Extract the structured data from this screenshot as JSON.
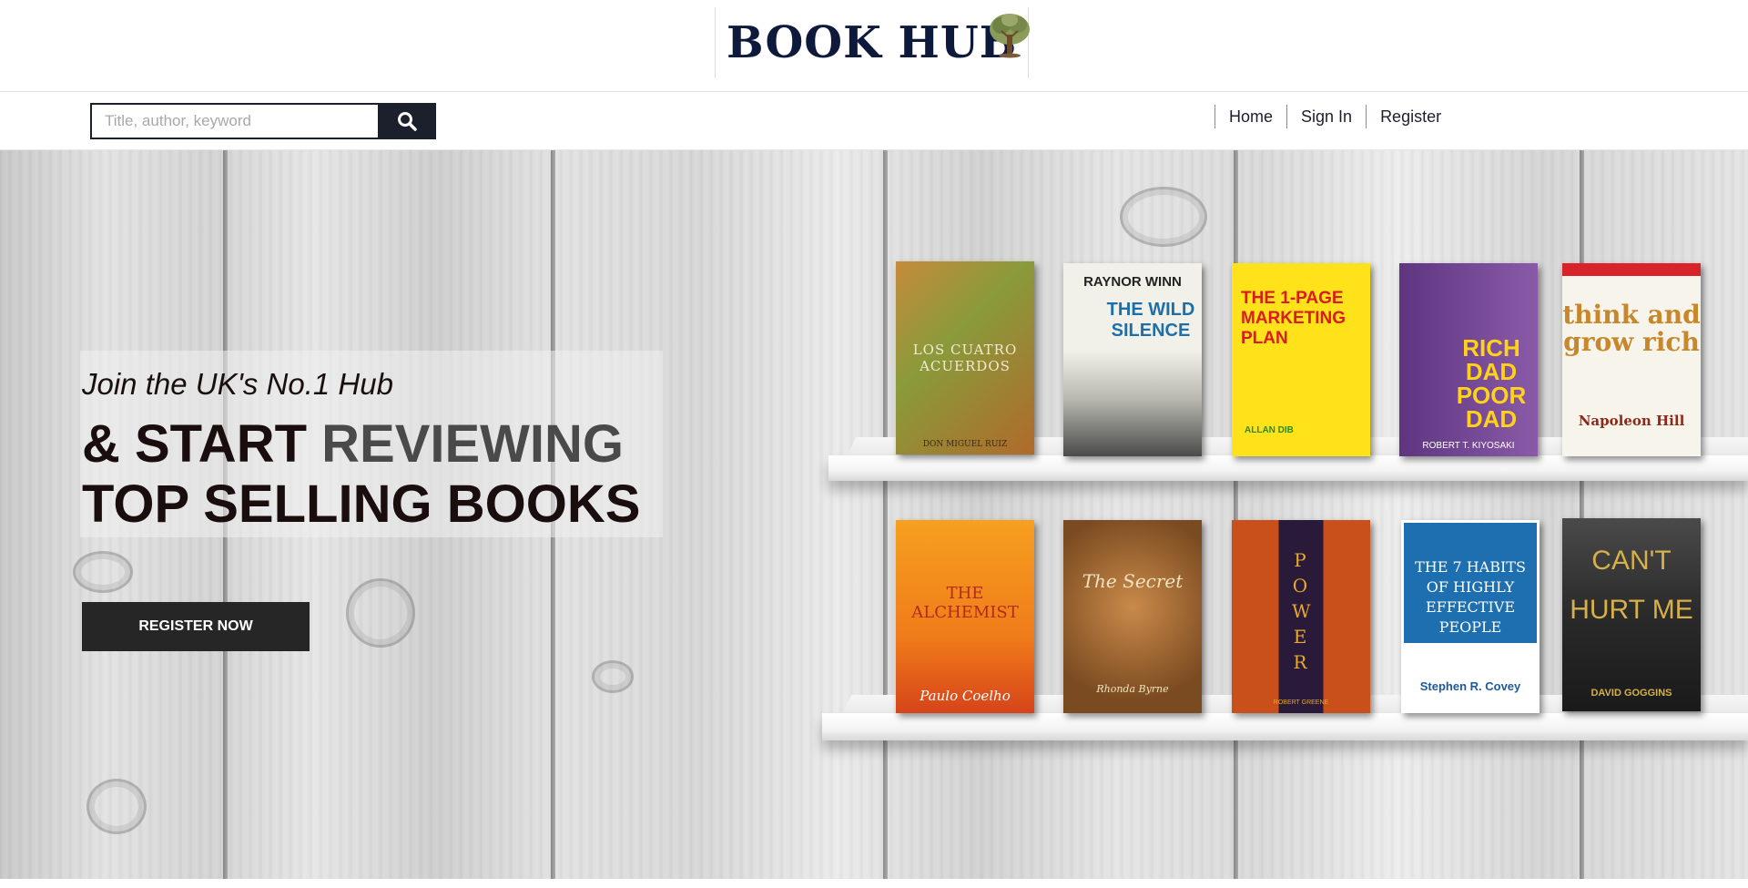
{
  "site": {
    "logo_text": "BOOK HUB",
    "logo_icon": "tree-icon"
  },
  "search": {
    "placeholder": "Title, author, keyword",
    "button_icon": "search-icon"
  },
  "nav": {
    "items": [
      {
        "label": "Home"
      },
      {
        "label": "Sign In"
      },
      {
        "label": "Register"
      }
    ]
  },
  "hero": {
    "kicker": "Join the UK's No.1 Hub",
    "headline_part1": "& START ",
    "headline_accent": "REVIEWING",
    "headline_line2": "TOP SELLING BOOKS",
    "cta_label": "REGISTER NOW"
  },
  "shelves": {
    "top": [
      {
        "title": "LOS CUATRO ACUERDOS",
        "author": "DON MIGUEL RUIZ",
        "cover": "#b8742a"
      },
      {
        "title": "THE WILD SILENCE",
        "author": "RAYNOR WINN",
        "cover": "#e8e8e0"
      },
      {
        "title": "THE 1-PAGE MARKETING PLAN",
        "author": "ALLAN DIB",
        "cover": "#ffe21a"
      },
      {
        "title": "RICH DAD POOR DAD",
        "author": "ROBERT T. KIYOSAKI",
        "cover": "#6a3a86"
      },
      {
        "title": "think and grow rich",
        "author": "Napoleon Hill",
        "cover": "#f5f2ea"
      }
    ],
    "bottom": [
      {
        "title": "THE ALCHEMIST",
        "author": "Paulo Coelho",
        "cover": "#f08a1e"
      },
      {
        "title": "The Secret",
        "author": "Rhonda Byrne",
        "cover": "#a4692c"
      },
      {
        "title": "POWER",
        "author": "ROBERT GREENE",
        "cover": "#c9501a"
      },
      {
        "title": "THE 7 HABITS OF HIGHLY EFFECTIVE PEOPLE",
        "author": "Stephen R. Covey",
        "cover": "#1e6fb0"
      },
      {
        "title": "CAN'T HURT ME",
        "author": "DAVID GOGGINS",
        "cover": "#3a3a3a"
      }
    ]
  }
}
